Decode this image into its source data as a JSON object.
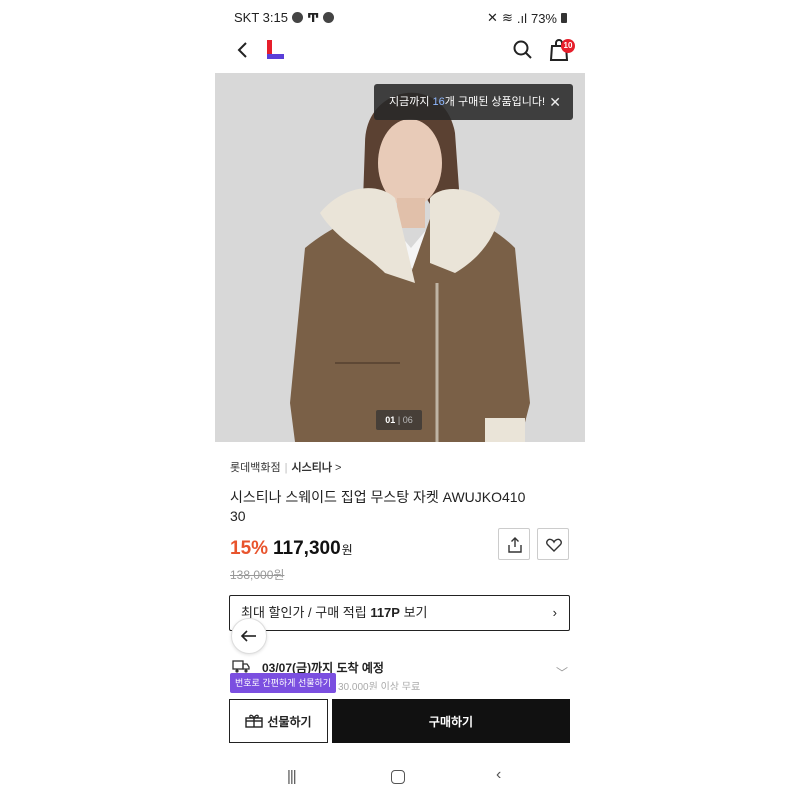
{
  "status_bar": {
    "carrier_time": "SKT 3:15",
    "battery": "73%"
  },
  "header": {
    "logo": "lotte-on-logo",
    "cart_count": "10"
  },
  "image": {
    "toast_prefix": "지금까지 ",
    "toast_count": "16",
    "toast_suffix": "개 구매된 상품입니다!",
    "counter_current": "01",
    "counter_total": "06"
  },
  "product": {
    "store": "롯데백화점",
    "brand": "시스티나",
    "brand_chevron": ">",
    "title": "시스티나 스웨이드 집업 무스탕 자켓 AWUJKO410 30",
    "discount": "15%",
    "price": "117,300",
    "currency": "원",
    "original_price": "138,000원"
  },
  "benefit": {
    "prefix": "최대 할인가 / 구매 적립 ",
    "points": "117P",
    "suffix": " 보기"
  },
  "delivery": {
    "date_text": "03/07(금)까지 도착 예정",
    "sub_text": "30,000원 이상 무료"
  },
  "gift_tooltip": "번호로 간편하게 선물하기",
  "bottom": {
    "gift_label": "선물하기",
    "buy_label": "구매하기"
  },
  "icons": {
    "back": "back-arrow-icon",
    "search": "search-icon",
    "cart": "shopping-bag-icon",
    "share": "share-icon",
    "wish": "heart-icon"
  },
  "colors": {
    "discount": "#e8542d",
    "gift_tooltip": "#7b4fe0",
    "buy_button": "#111111",
    "badge": "#e61e2b"
  }
}
